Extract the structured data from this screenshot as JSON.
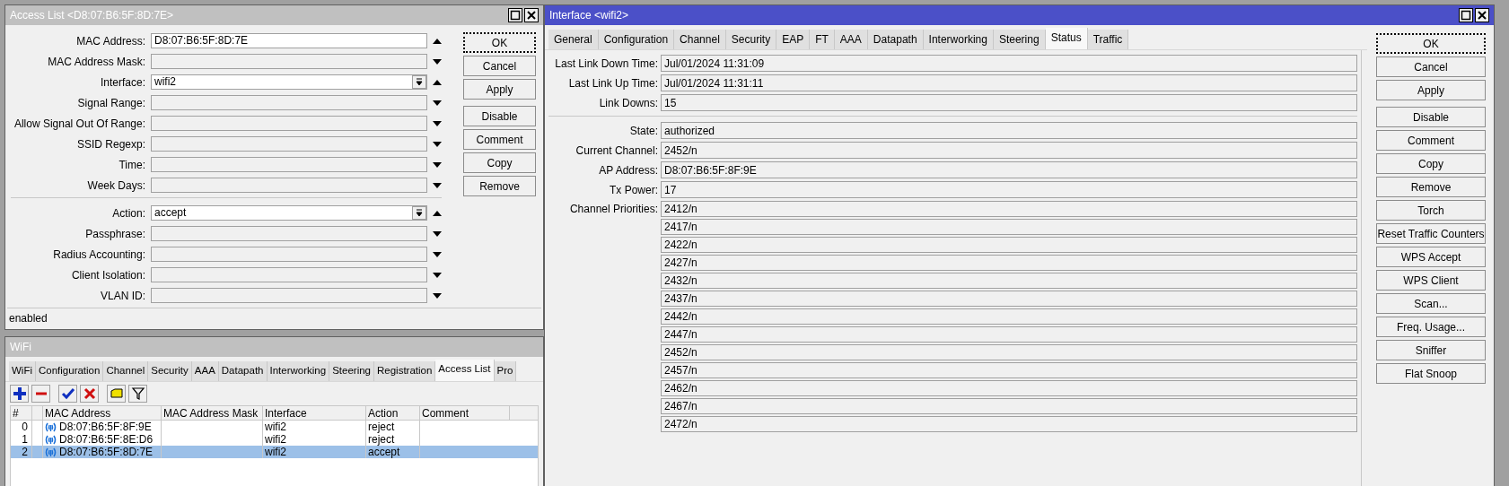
{
  "access_list_window": {
    "title": "Access List <D8:07:B6:5F:8D:7E>",
    "active": false,
    "sections": [
      [
        {
          "label": "MAC Address:",
          "value": "D8:07:B6:5F:8D:7E",
          "kind": "text"
        },
        {
          "label": "MAC Address Mask:",
          "kind": "unset"
        },
        {
          "label": "Interface:",
          "value": "wifi2",
          "kind": "select"
        },
        {
          "label": "Signal Range:",
          "kind": "unset"
        },
        {
          "label": "Allow Signal Out Of Range:",
          "kind": "unset"
        },
        {
          "label": "SSID Regexp:",
          "kind": "unset"
        },
        {
          "label": "Time:",
          "kind": "unset"
        },
        {
          "label": "Week Days:",
          "kind": "unset"
        }
      ],
      [
        {
          "label": "Action:",
          "value": "accept",
          "kind": "select"
        },
        {
          "label": "Passphrase:",
          "kind": "unset"
        },
        {
          "label": "Radius Accounting:",
          "kind": "unset"
        },
        {
          "label": "Client Isolation:",
          "kind": "unset"
        },
        {
          "label": "VLAN ID:",
          "kind": "unset"
        }
      ]
    ],
    "buttons": [
      {
        "label": "OK",
        "focused": true
      },
      {
        "label": "Cancel",
        "focused": false
      },
      {
        "label": "Apply",
        "focused": false
      },
      {
        "label": "Disable",
        "focused": false
      },
      {
        "label": "Comment",
        "focused": false
      },
      {
        "label": "Copy",
        "focused": false
      },
      {
        "label": "Remove",
        "focused": false
      }
    ],
    "status": "enabled"
  },
  "wifi_window": {
    "title": "WiFi",
    "active": false,
    "tabs": [
      {
        "label": "WiFi",
        "selected": false
      },
      {
        "label": "Configuration",
        "selected": false
      },
      {
        "label": "Channel",
        "selected": false
      },
      {
        "label": "Security",
        "selected": false
      },
      {
        "label": "AAA",
        "selected": false
      },
      {
        "label": "Datapath",
        "selected": false
      },
      {
        "label": "Interworking",
        "selected": false
      },
      {
        "label": "Steering",
        "selected": false
      },
      {
        "label": "Registration",
        "selected": false
      },
      {
        "label": "Access List",
        "selected": true
      },
      {
        "label": "Pro",
        "selected": false
      }
    ],
    "table": {
      "columns": [
        "#",
        "MAC Address",
        "MAC Address Mask",
        "Interface",
        "Action",
        "Comment"
      ],
      "rows": [
        {
          "index": "0",
          "mac": "D8:07:B6:5F:8F:9E",
          "interface": "wifi2",
          "action": "reject",
          "selected": false
        },
        {
          "index": "1",
          "mac": "D8:07:B6:5F:8E:D6",
          "interface": "wifi2",
          "action": "reject",
          "selected": false
        },
        {
          "index": "2",
          "mac": "D8:07:B6:5F:8D:7E",
          "interface": "wifi2",
          "action": "accept",
          "selected": true
        }
      ]
    }
  },
  "interface_window": {
    "title": "Interface <wifi2>",
    "active": true,
    "tabs": [
      {
        "label": "General",
        "selected": false
      },
      {
        "label": "Configuration",
        "selected": false
      },
      {
        "label": "Channel",
        "selected": false
      },
      {
        "label": "Security",
        "selected": false
      },
      {
        "label": "EAP",
        "selected": false
      },
      {
        "label": "FT",
        "selected": false
      },
      {
        "label": "AAA",
        "selected": false
      },
      {
        "label": "Datapath",
        "selected": false
      },
      {
        "label": "Interworking",
        "selected": false
      },
      {
        "label": "Steering",
        "selected": false
      },
      {
        "label": "Status",
        "selected": true
      },
      {
        "label": "Traffic",
        "selected": false
      }
    ],
    "sections": [
      [
        {
          "label": "Last Link Down Time:",
          "value": "Jul/01/2024 11:31:09"
        },
        {
          "label": "Last Link Up Time:",
          "value": "Jul/01/2024 11:31:11"
        },
        {
          "label": "Link Downs:",
          "value": "15"
        }
      ],
      [
        {
          "label": "State:",
          "value": "authorized"
        },
        {
          "label": "Current Channel:",
          "value": "2452/n"
        },
        {
          "label": "AP Address:",
          "value": "D8:07:B6:5F:8F:9E"
        },
        {
          "label": "Tx Power:",
          "value": "17"
        }
      ]
    ],
    "channel_priorities": {
      "label": "Channel Priorities:",
      "values": [
        "2412/n",
        "2417/n",
        "2422/n",
        "2427/n",
        "2432/n",
        "2437/n",
        "2442/n",
        "2447/n",
        "2452/n",
        "2457/n",
        "2462/n",
        "2467/n",
        "2472/n"
      ]
    },
    "buttons": [
      {
        "label": "OK",
        "focused": true
      },
      {
        "label": "Cancel",
        "focused": false
      },
      {
        "label": "Apply",
        "focused": false
      },
      {
        "label": "Disable",
        "focused": false
      },
      {
        "label": "Comment",
        "focused": false
      },
      {
        "label": "Copy",
        "focused": false
      },
      {
        "label": "Remove",
        "focused": false
      },
      {
        "label": "Torch",
        "focused": false
      },
      {
        "label": "Reset Traffic Counters",
        "focused": false
      },
      {
        "label": "WPS Accept",
        "focused": false
      },
      {
        "label": "WPS Client",
        "focused": false
      },
      {
        "label": "Scan...",
        "focused": false
      },
      {
        "label": "Freq. Usage...",
        "focused": false
      },
      {
        "label": "Sniffer",
        "focused": false
      },
      {
        "label": "Flat Snoop",
        "focused": false
      }
    ]
  }
}
